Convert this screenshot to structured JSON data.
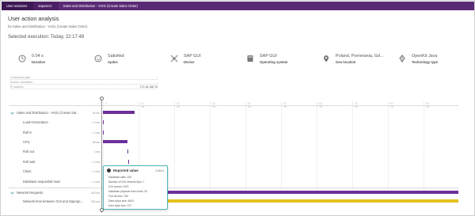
{
  "breadcrumbs": [
    "User sessions",
    "sapuser1",
    "Sales and Distribution - VA01 (Create Sales Order)"
  ],
  "page": {
    "title": "User action analysis",
    "subtitle": "for Sales and Distribution - VA01 (Create Sales Order)",
    "selected_execution": "Selected execution: Today, 22:17:48"
  },
  "tiles": [
    {
      "icon": "clock-icon",
      "value": "0.04 s",
      "label": "Duration"
    },
    {
      "icon": "smiley-icon",
      "value": "Satisfied",
      "label": "Apdex"
    },
    {
      "icon": "satellite-icon",
      "value": "SAP GUI",
      "label": "Device"
    },
    {
      "icon": "app-window-icon",
      "value": "SAP GUI",
      "label": "Operating system"
    },
    {
      "icon": "location-pin-icon",
      "value": "Poland, Pomerania, Gd...",
      "label": "Geo location"
    },
    {
      "icon": "kite-icon",
      "value": "OpenKit Java",
      "label": "Technology type"
    }
  ],
  "properties": [
    {
      "label": "Connection type",
      "value": "-"
    },
    {
      "label": "Screen orientation",
      "value": "-"
    },
    {
      "label": "IP address",
      "value": "172.18.158.78"
    }
  ],
  "timeline": {
    "ticks": [
      "0",
      "10 ms",
      "20 ms",
      "30 ms",
      "40 ms",
      "50 ms",
      "60 ms",
      "70 ms",
      "80 ms",
      "90 ms"
    ],
    "rows": [
      {
        "name": "Sales and Distribution - VA01 (Create Sal...",
        "duration": "44 ms",
        "expand": true
      },
      {
        "name": "Load+Generation",
        "duration": "< 1 ms"
      },
      {
        "name": "Roll in",
        "duration": "< 1 ms"
      },
      {
        "name": "CPU",
        "duration": "35 ms"
      },
      {
        "name": "Roll out",
        "duration": "1 ms"
      },
      {
        "name": "Roll wait",
        "duration": "< 1 ms"
      },
      {
        "name": "Client",
        "duration": "< 1 ms"
      },
      {
        "name": "Database sequential read",
        "duration": "< 1 ms"
      },
      {
        "name": "Network Requests",
        "duration": "420 ms",
        "expand": true
      },
      {
        "name": "Network time between GUI and SapApp...",
        "duration": "420 ms"
      }
    ]
  },
  "tooltip": {
    "title": "Reported value",
    "value": "0.04 s",
    "lines": [
      "Database calls: 105",
      "Number of GUI network trips: 7",
      "GUI screen: 0101",
      "Database physical read count: 20",
      "GUI version: 760",
      "Data in/out size: 4624",
      "User input size: 127"
    ]
  },
  "colors": {
    "brand": "#5a2a75",
    "bar_purple": "#6b2f9a",
    "bar_yellow": "#e6c21d",
    "tooltip_border": "#4fb6b9"
  }
}
